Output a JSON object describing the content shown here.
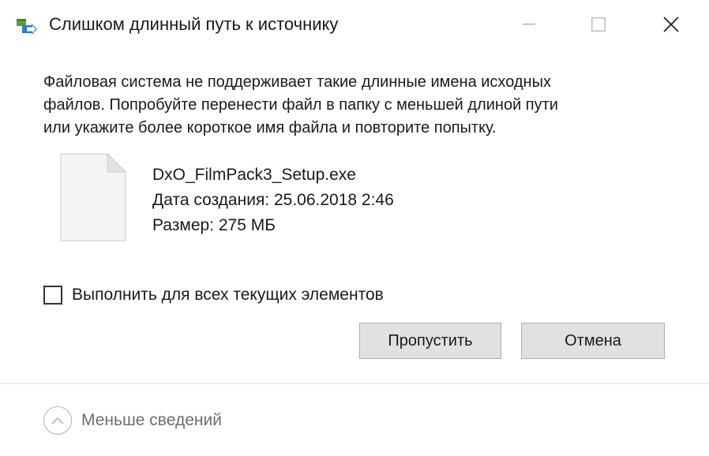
{
  "window": {
    "title": "Слишком длинный путь к источнику",
    "controls": {
      "minimize": "minimize-icon",
      "maximize": "maximize-icon",
      "close": "close-icon"
    }
  },
  "message": {
    "line1": "Файловая система не поддерживает такие длинные имена исходных",
    "line2": "файлов. Попробуйте перенести файл в папку с меньшей длиной пути",
    "line3": "или укажите более короткое имя файла и повторите попытку."
  },
  "file": {
    "icon": "file-icon",
    "name": "DxO_FilmPack3_Setup.exe",
    "created": "Дата создания: 25.06.2018 2:46",
    "size": "Размер: 275 МБ"
  },
  "checkbox": {
    "label": "Выполнить для всех текущих элементов",
    "checked": false
  },
  "buttons": {
    "skip": "Пропустить",
    "cancel": "Отмена"
  },
  "footer": {
    "details_label": "Меньше сведений",
    "icon": "chevron-up-icon"
  },
  "colors": {
    "button_bg": "#e1e1e1",
    "button_border": "#adadad",
    "secondary_text": "#6d6d6d"
  }
}
